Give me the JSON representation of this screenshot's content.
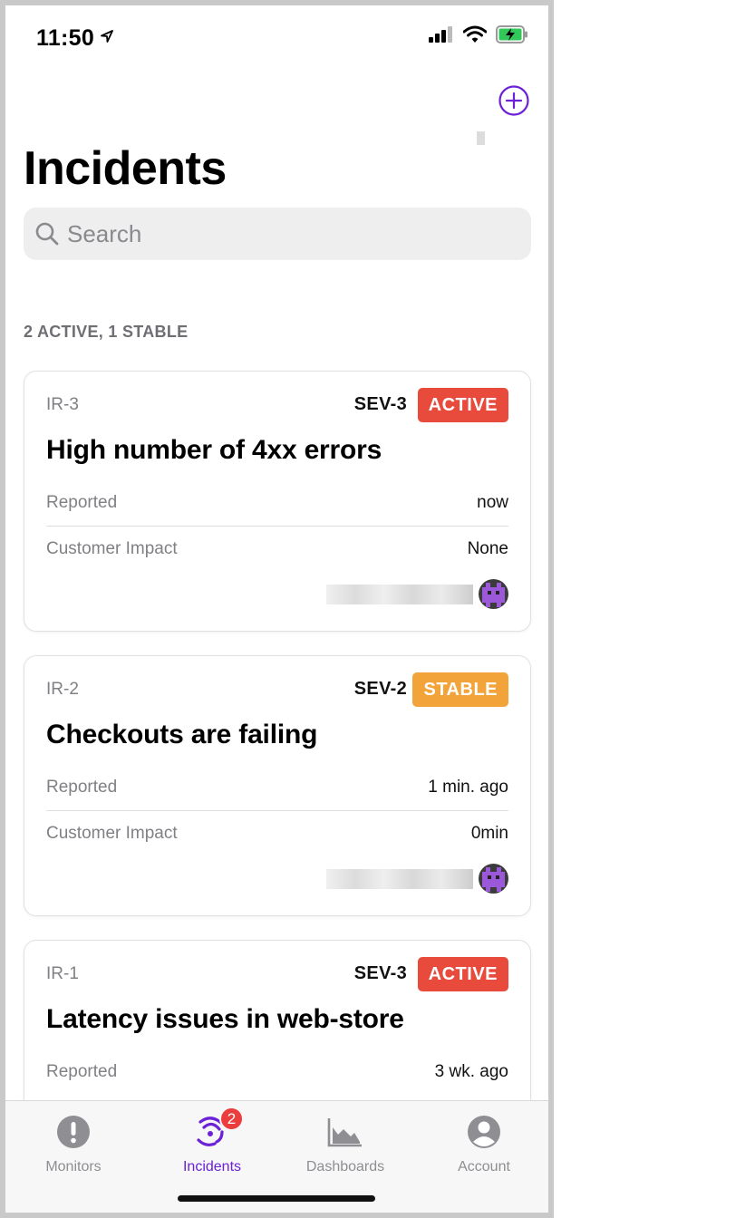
{
  "status_bar": {
    "time": "11:50"
  },
  "header": {
    "title": "Incidents"
  },
  "search": {
    "placeholder": "Search"
  },
  "summary": "2 ACTIVE, 1 STABLE",
  "colors": {
    "accent": "#6b21d6",
    "active": "#e84a3c",
    "stable": "#f2a33a",
    "badge": "#eb3d3d"
  },
  "incidents": [
    {
      "id": "IR-3",
      "severity": "SEV-3",
      "status": "ACTIVE",
      "title": "High number of 4xx errors",
      "reported_label": "Reported",
      "reported_value": "now",
      "impact_label": "Customer Impact",
      "impact_value": "None"
    },
    {
      "id": "IR-2",
      "severity": "SEV-2",
      "status": "STABLE",
      "title": "Checkouts are failing",
      "reported_label": "Reported",
      "reported_value": "1 min. ago",
      "impact_label": "Customer Impact",
      "impact_value": "0min"
    },
    {
      "id": "IR-1",
      "severity": "SEV-3",
      "status": "ACTIVE",
      "title": "Latency issues in web-store",
      "reported_label": "Reported",
      "reported_value": "3 wk. ago"
    }
  ],
  "tabbar": {
    "tabs": [
      {
        "label": "Monitors",
        "icon": "exclamation-circle-icon"
      },
      {
        "label": "Incidents",
        "icon": "incidents-signal-icon",
        "badge": "2"
      },
      {
        "label": "Dashboards",
        "icon": "area-chart-icon"
      },
      {
        "label": "Account",
        "icon": "person-circle-icon"
      }
    ]
  }
}
